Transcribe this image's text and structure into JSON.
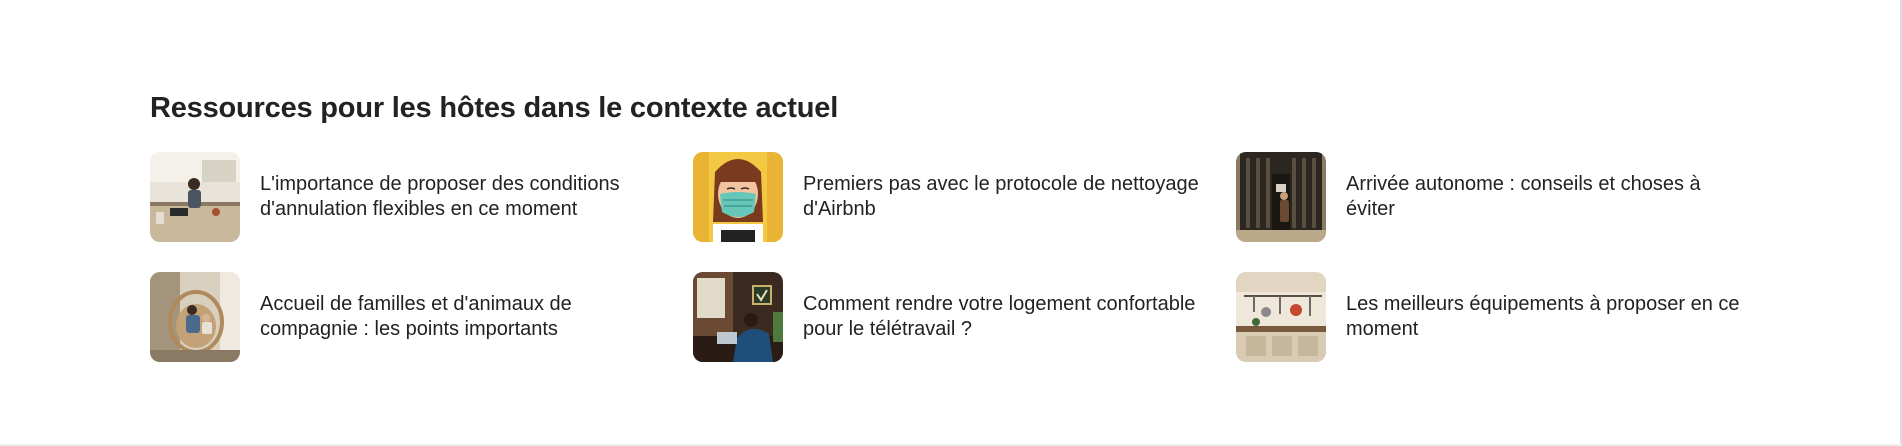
{
  "section": {
    "title": "Ressources pour les hôtes dans le contexte actuel"
  },
  "articles": [
    {
      "label": "L'importance de proposer des conditions d'annulation flexibles en ce moment",
      "image": "woman-in-kitchen-with-laptop"
    },
    {
      "label": "Premiers pas avec le protocole de nettoyage d'Airbnb",
      "image": "woman-wearing-mask-illustration"
    },
    {
      "label": "Arrivée autonome : conseils et choses à éviter",
      "image": "person-at-front-door"
    },
    {
      "label": "Accueil de familles et d'animaux de compagnie : les points importants",
      "image": "family-in-hanging-chair"
    },
    {
      "label": "Comment rendre votre logement confortable pour le télétravail ?",
      "image": "person-working-at-desk"
    },
    {
      "label": "Les meilleurs équipements à proposer en ce moment",
      "image": "kitchen-with-hanging-utensils"
    }
  ]
}
